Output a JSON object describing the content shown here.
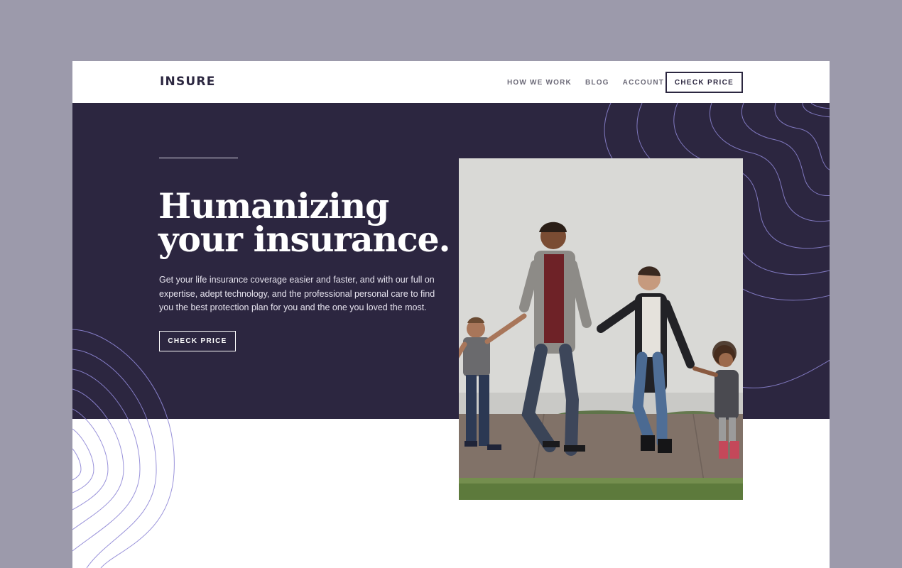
{
  "header": {
    "logo": "INSURE",
    "nav": [
      {
        "label": "HOW WE WORK"
      },
      {
        "label": "BLOG"
      },
      {
        "label": "ACCOUNT"
      }
    ],
    "cta_label": "CHECK PRICE"
  },
  "hero": {
    "title_line1": "Humanizing",
    "title_line2": "your insurance.",
    "description": "Get your life insurance coverage easier and faster, and with our full on expertise, adept technology, and the professional personal care to find you the best protection plan for you and the one you loved the most.",
    "cta_label": "CHECK PRICE",
    "image_subject": "family-walking-photo"
  },
  "colors": {
    "page_bg": "#9c9aab",
    "hero_bg": "#2c2640",
    "accent_line": "#8f87d6",
    "text_dark": "#2c2740"
  }
}
